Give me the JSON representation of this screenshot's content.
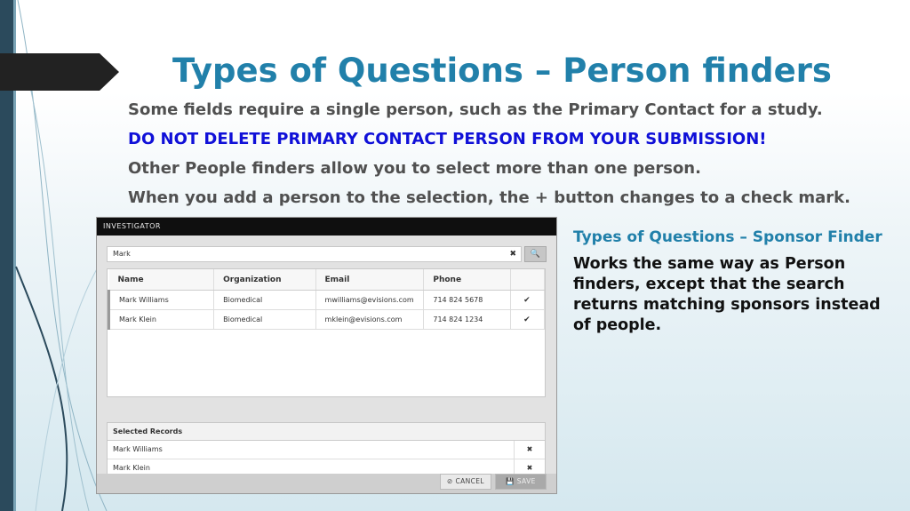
{
  "slide": {
    "title": "Types of Questions – Person finders",
    "bullet_glyph": "",
    "bullets": [
      "Some fields require a single person, such as the Primary Contact for a study.",
      "DO NOT DELETE PRIMARY CONTACT PERSON FROM YOUR SUBMISSION!",
      "Other People finders allow you to select more than one person.",
      "When you add a person to the selection, the + button changes to a check mark."
    ],
    "warning_color": "#1010d8",
    "title_color": "#2180aa"
  },
  "dialog": {
    "header": "INVESTIGATOR",
    "search_value": "Mark",
    "clear_glyph": "✖",
    "search_glyph": "🔍",
    "columns": [
      "Name",
      "Organization",
      "Email",
      "Phone"
    ],
    "rows": [
      {
        "name": "Mark Williams",
        "org": "Biomedical",
        "email": "mwilliams@evisions.com",
        "phone": "714 824 5678",
        "status": "✔"
      },
      {
        "name": "Mark Klein",
        "org": "Biomedical",
        "email": "mklein@evisions.com",
        "phone": "714 824 1234",
        "status": "✔"
      }
    ],
    "selected_header": "Selected Records",
    "selected": [
      {
        "name": "Mark Williams",
        "remove": "✖"
      },
      {
        "name": "Mark Klein",
        "remove": "✖"
      }
    ],
    "cancel_label": "⊘ CANCEL",
    "save_label": "💾 SAVE"
  },
  "side": {
    "title": "Types of Questions – Sponsor Finder",
    "text": "Works the same way as Person finders, except that the search returns matching sponsors instead of people."
  }
}
